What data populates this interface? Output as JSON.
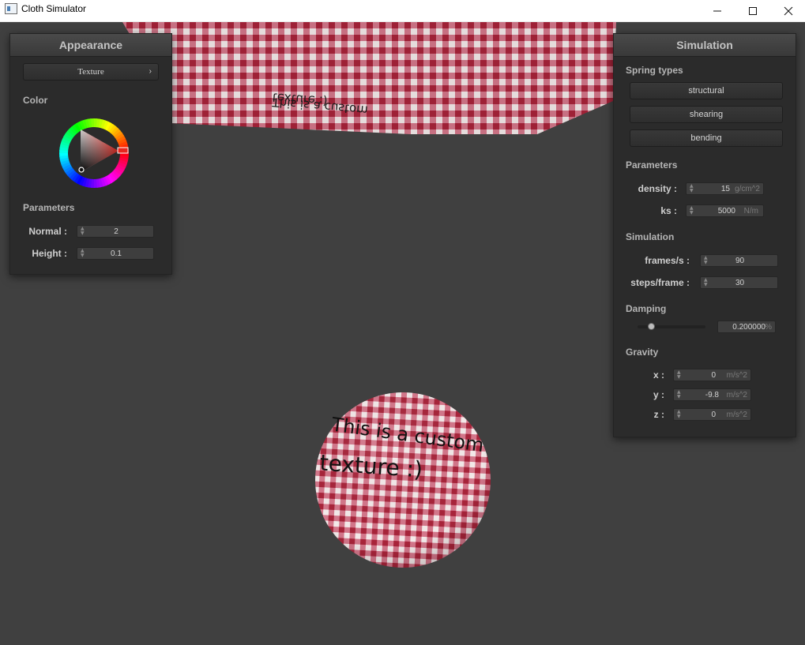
{
  "window": {
    "title": "Cloth Simulator",
    "minimize_icon": "minimize-icon",
    "maximize_icon": "maximize-icon",
    "close_icon": "close-icon"
  },
  "appearance": {
    "title": "Appearance",
    "shader_button": "Texture",
    "color_label": "Color",
    "color_wheel": {
      "selected_hue": "#e8261e"
    },
    "parameters_label": "Parameters",
    "params": [
      {
        "label": "Normal :",
        "value": "2"
      },
      {
        "label": "Height :",
        "value": "0.1"
      }
    ]
  },
  "simulation": {
    "title": "Simulation",
    "spring_types_label": "Spring types",
    "spring_buttons": [
      "structural",
      "shearing",
      "bending"
    ],
    "parameters_label": "Parameters",
    "params": [
      {
        "label": "density :",
        "value": "15",
        "unit": "g/cm^2"
      },
      {
        "label": "ks :",
        "value": "5000",
        "unit": "N/m"
      }
    ],
    "simulation_label": "Simulation",
    "sim_params": [
      {
        "label": "frames/s :",
        "value": "90"
      },
      {
        "label": "steps/frame :",
        "value": "30"
      }
    ],
    "damping_label": "Damping",
    "damping": {
      "value": "0.200000",
      "unit": "%",
      "slider_fraction": 0.2
    },
    "gravity_label": "Gravity",
    "gravity": [
      {
        "label": "x :",
        "value": "0",
        "unit": "m/s^2"
      },
      {
        "label": "y :",
        "value": "-9.8",
        "unit": "m/s^2"
      },
      {
        "label": "z :",
        "value": "0",
        "unit": "m/s^2"
      }
    ]
  },
  "scene": {
    "texture_text_line1": "This is a custom",
    "texture_text_line2": "texture :)",
    "colors": {
      "check_dark": "#a8243a",
      "check_light": "#f4eaea",
      "background": "#404040"
    }
  }
}
